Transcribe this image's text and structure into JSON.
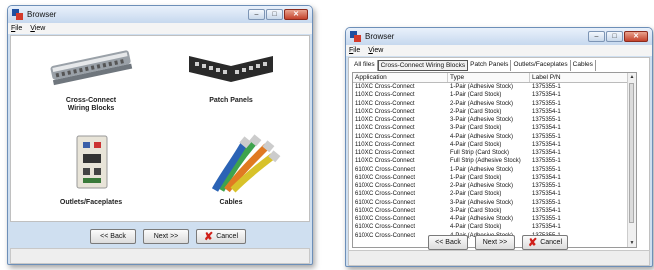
{
  "left_window": {
    "title": "Browser",
    "menu": [
      "File",
      "View"
    ],
    "tiles": [
      {
        "label": "Cross-Connect\nWiring Blocks"
      },
      {
        "label": "Patch Panels"
      },
      {
        "label": "Outlets/Faceplates"
      },
      {
        "label": "Cables"
      }
    ],
    "buttons": {
      "back": "<< Back",
      "next": "Next >>",
      "cancel": "Cancel"
    }
  },
  "right_window": {
    "title": "Browser",
    "menu": [
      "File",
      "View"
    ],
    "tabs": [
      "All files",
      "Cross-Connect Wiring Blocks",
      "Patch Panels",
      "Outlets/Faceplates",
      "Cables"
    ],
    "active_tab": "Cross-Connect Wiring Blocks",
    "columns": [
      "Application",
      "Type",
      "Label P/N"
    ],
    "rows": [
      [
        "110XC Cross-Connect",
        "1-Pair (Adhesive Stock)",
        "1375355-1"
      ],
      [
        "110XC Cross-Connect",
        "1-Pair (Card Stock)",
        "1375354-1"
      ],
      [
        "110XC Cross-Connect",
        "2-Pair (Adhesive Stock)",
        "1375355-1"
      ],
      [
        "110XC Cross-Connect",
        "2-Pair (Card Stock)",
        "1375354-1"
      ],
      [
        "110XC Cross-Connect",
        "3-Pair (Adhesive Stock)",
        "1375355-1"
      ],
      [
        "110XC Cross-Connect",
        "3-Pair (Card Stock)",
        "1375354-1"
      ],
      [
        "110XC Cross-Connect",
        "4-Pair (Adhesive Stock)",
        "1375355-1"
      ],
      [
        "110XC Cross-Connect",
        "4-Pair (Card Stock)",
        "1375354-1"
      ],
      [
        "110XC Cross-Connect",
        "Full Strip (Card Stock)",
        "1375354-1"
      ],
      [
        "110XC Cross-Connect",
        "Full Strip (Adhesive Stock)",
        "1375355-1"
      ],
      [
        "610XC Cross-Connect",
        "1-Pair (Adhesive Stock)",
        "1375355-1"
      ],
      [
        "610XC Cross-Connect",
        "1-Pair (Card Stock)",
        "1375354-1"
      ],
      [
        "610XC Cross-Connect",
        "2-Pair (Adhesive Stock)",
        "1375355-1"
      ],
      [
        "610XC Cross-Connect",
        "2-Pair (Card Stock)",
        "1375354-1"
      ],
      [
        "610XC Cross-Connect",
        "3-Pair (Adhesive Stock)",
        "1375355-1"
      ],
      [
        "610XC Cross-Connect",
        "3-Pair (Card Stock)",
        "1375354-1"
      ],
      [
        "610XC Cross-Connect",
        "4-Pair (Adhesive Stock)",
        "1375355-1"
      ],
      [
        "610XC Cross-Connect",
        "4-Pair (Card Stock)",
        "1375354-1"
      ],
      [
        "610XC Cross-Connect",
        "4-Pair (Adhesive Stock)",
        "1375355-1"
      ]
    ],
    "buttons": {
      "back": "<< Back",
      "next": "Next >>",
      "cancel": "Cancel"
    }
  },
  "colors": {
    "titlebar": "#c6d8ee",
    "close": "#c4422b",
    "cancel_x": "#d0201a"
  }
}
